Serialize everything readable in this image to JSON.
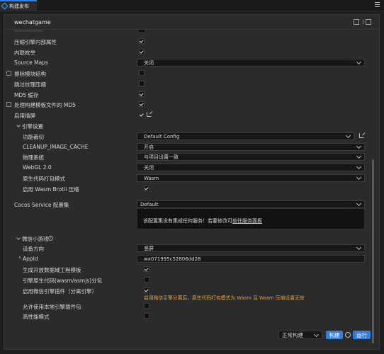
{
  "tab": {
    "title": "构建发布"
  },
  "panel": {
    "title": "wechatgame"
  },
  "rows": {
    "compress_engine_attrs": {
      "label": "压缩引擎内部属性",
      "checked": true
    },
    "inline_enum": {
      "label": "内联枚举",
      "checked": true
    },
    "source_maps": {
      "label": "Source Maps",
      "value": "关闭"
    },
    "remove_module_struct": {
      "label": "擦除模块结构",
      "checked": false
    },
    "skip_texture_compress": {
      "label": "跳过纹理压缩",
      "checked": false
    },
    "md5_cache": {
      "label": "MD5 缓存",
      "checked": true
    },
    "process_md5": {
      "label": "处理构建模板文件的 MD5",
      "checked": true
    },
    "splash_screen": {
      "label": "启用插屏",
      "checked": true
    }
  },
  "engine_settings": {
    "label": "引擎设置",
    "feature_cropping": {
      "label": "功能裁切",
      "value": "Default Config"
    },
    "cleanup_image_cache": {
      "label": "CLEANUP_IMAGE_CACHE",
      "value": "开启"
    },
    "physics_system": {
      "label": "物理系统",
      "value": "与项目设置一致"
    },
    "webgl": {
      "label": "WebGL 2.0",
      "value": "关闭"
    },
    "native_code_mode": {
      "label": "原生代码打包模式",
      "value": "Wasm"
    },
    "wasm_brotli": {
      "label": "启用 Wasm Brotli 压缩",
      "checked": true
    }
  },
  "cocos_service": {
    "label": "Cocos Service 配置集",
    "value": "Default",
    "message": "该配置集没有集成任何服务！若要修改可",
    "link": "前往服务面板"
  },
  "wechat_game": {
    "label": "微信小游戏",
    "orientation": {
      "label": "设备方向",
      "value": "竖屏"
    },
    "appid": {
      "label": "AppId",
      "value": "wx071995c52806dd28"
    },
    "open_data_context": {
      "label": "生成开放数据域工程模板",
      "checked": true
    },
    "native_wasm_subpackage": {
      "label": "引擎原生代码(wasm/asmjs)分包",
      "checked": false
    },
    "wechat_engine_plugin": {
      "label": "启用微信引擎插件（分离引擎）",
      "checked": true,
      "warning": "启用微信引擎分离后，原生代码打包模式为 Wasm 且 Wasm 压缩设置无效"
    },
    "local_plugin": {
      "label": "允许使用本地引擎插件包",
      "checked": false
    },
    "high_performance": {
      "label": "高性能模式",
      "checked": false
    }
  },
  "footer": {
    "build_mode": "正常构建",
    "build_button": "构建",
    "run_button": "运行"
  }
}
